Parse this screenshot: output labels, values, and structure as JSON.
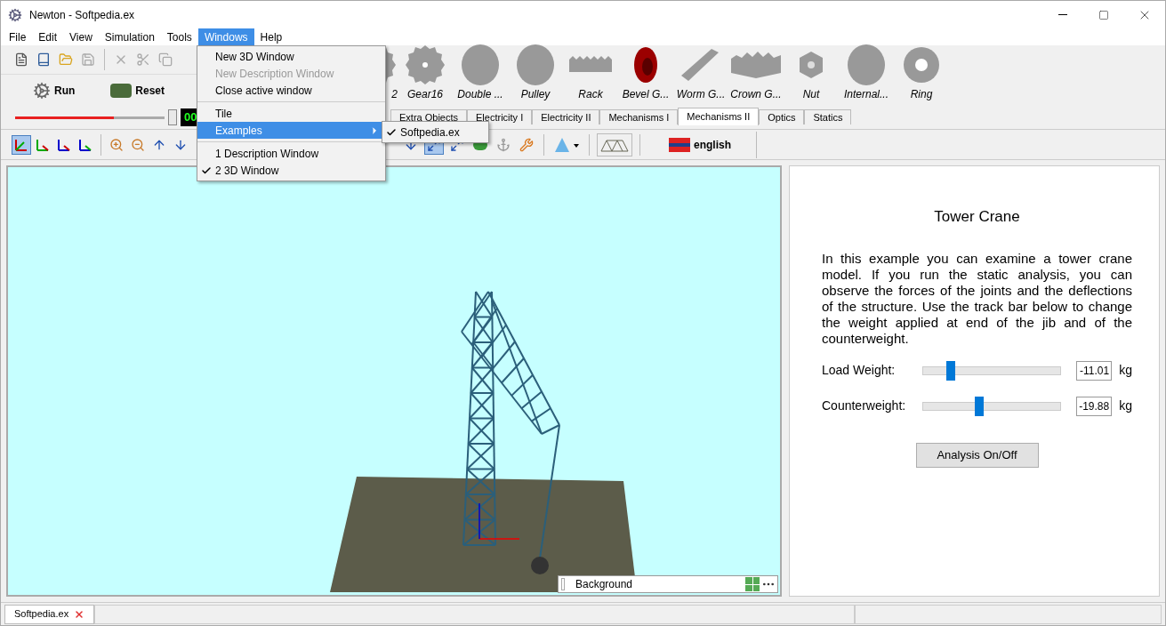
{
  "window": {
    "title": "Newton - Softpedia.ex"
  },
  "menu": [
    {
      "label": "File",
      "selected": false
    },
    {
      "label": "Edit",
      "selected": false
    },
    {
      "label": "View",
      "selected": false
    },
    {
      "label": "Simulation",
      "selected": false
    },
    {
      "label": "Tools",
      "selected": false
    },
    {
      "label": "Windows",
      "selected": true
    },
    {
      "label": "Help",
      "selected": false
    }
  ],
  "dropdown": {
    "groups": [
      [
        {
          "label": "New 3D Window",
          "disabled": false,
          "checked": false,
          "submenu": false,
          "selected": false
        },
        {
          "label": "New Description Window",
          "disabled": true,
          "checked": false,
          "submenu": false,
          "selected": false
        },
        {
          "label": "Close active window",
          "disabled": false,
          "checked": false,
          "submenu": false,
          "selected": false
        }
      ],
      [
        {
          "label": "Tile",
          "disabled": false,
          "checked": false,
          "submenu": false,
          "selected": false
        },
        {
          "label": "Examples",
          "disabled": false,
          "checked": false,
          "submenu": true,
          "selected": true
        }
      ],
      [
        {
          "label": "1 Description Window",
          "disabled": false,
          "checked": false,
          "submenu": false,
          "selected": false
        },
        {
          "label": "2 3D Window",
          "disabled": false,
          "checked": true,
          "submenu": false,
          "selected": false
        }
      ]
    ],
    "submenu": [
      {
        "label": "Softpedia.ex",
        "checked": true
      }
    ]
  },
  "controls": {
    "run": "Run",
    "reset": "Reset",
    "progress": {
      "level": 0.66
    },
    "display": "00"
  },
  "palette": [
    {
      "label": "2",
      "kind": "gear"
    },
    {
      "label": "Gear16",
      "kind": "gear"
    },
    {
      "label": "Double ...",
      "kind": "disc"
    },
    {
      "label": "Pulley",
      "kind": "disc"
    },
    {
      "label": "Rack",
      "kind": "rack"
    },
    {
      "label": "Bevel G...",
      "kind": "bevel"
    },
    {
      "label": "Worm G...",
      "kind": "worm"
    },
    {
      "label": "Crown G...",
      "kind": "crown"
    },
    {
      "label": "Nut",
      "kind": "nut"
    },
    {
      "label": "Internal...",
      "kind": "disc"
    },
    {
      "label": "Ring",
      "kind": "ring"
    }
  ],
  "tabs": [
    {
      "label": "Extra Objects",
      "selected": false
    },
    {
      "label": "Electricity I",
      "selected": false
    },
    {
      "label": "Electricity II",
      "selected": false
    },
    {
      "label": "Mechanisms I",
      "selected": false
    },
    {
      "label": "Mechanisms II",
      "selected": true
    },
    {
      "label": "Optics",
      "selected": false
    },
    {
      "label": "Statics",
      "selected": false
    }
  ],
  "language": "english",
  "view": {
    "overlay": "Background"
  },
  "description": {
    "title": "Tower Crane",
    "text": "In this example you can examine a tower crane model. If you run the static analysis, you can observe the forces of the joints and the deflections of the structure. Use the track bar below to change the weight applied at end of the jib and of the counterweight.",
    "sliders": [
      {
        "label": "Load Weight:",
        "level": 0.19,
        "value": "-11.01",
        "unit": "kg"
      },
      {
        "label": "Counterweight:",
        "level": 0.38,
        "value": "-19.88",
        "unit": "kg"
      }
    ],
    "button": "Analysis On/Off"
  },
  "status_bar": {
    "tab": "Softpedia.ex"
  }
}
